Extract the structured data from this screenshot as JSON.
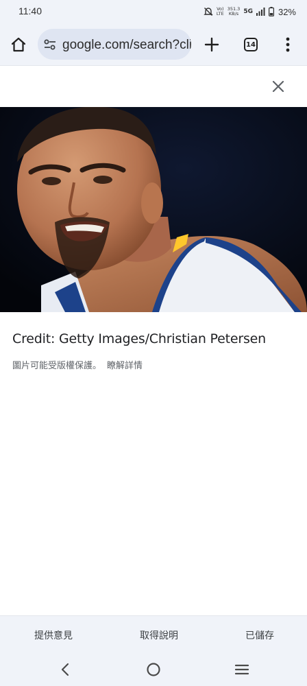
{
  "status_bar": {
    "time": "11:40",
    "volte_top": "Vo)",
    "volte_bottom": "LTE",
    "speed_value": "351.3",
    "speed_unit": "KB/s",
    "network": "5G",
    "battery_percent": "32%"
  },
  "browser": {
    "url": "google.com/search?client",
    "tab_count": "14",
    "icons": [
      "home-icon",
      "tune-icon",
      "plus-icon",
      "tab-switcher-icon",
      "more-vert-icon"
    ]
  },
  "viewer": {
    "credit": "Credit: Getty Images/Christian Petersen",
    "copyright_notice": "圖片可能受版權保護。",
    "details_link": "瞭解詳情"
  },
  "bottom_actions": {
    "feedback": "提供意見",
    "help": "取得說明",
    "saved": "已儲存"
  },
  "colors": {
    "chrome_bg": "#f0f3f9",
    "url_pill": "#dfe5f2",
    "jersey_blue": "#1d428a",
    "jersey_gold": "#ffc72c"
  }
}
